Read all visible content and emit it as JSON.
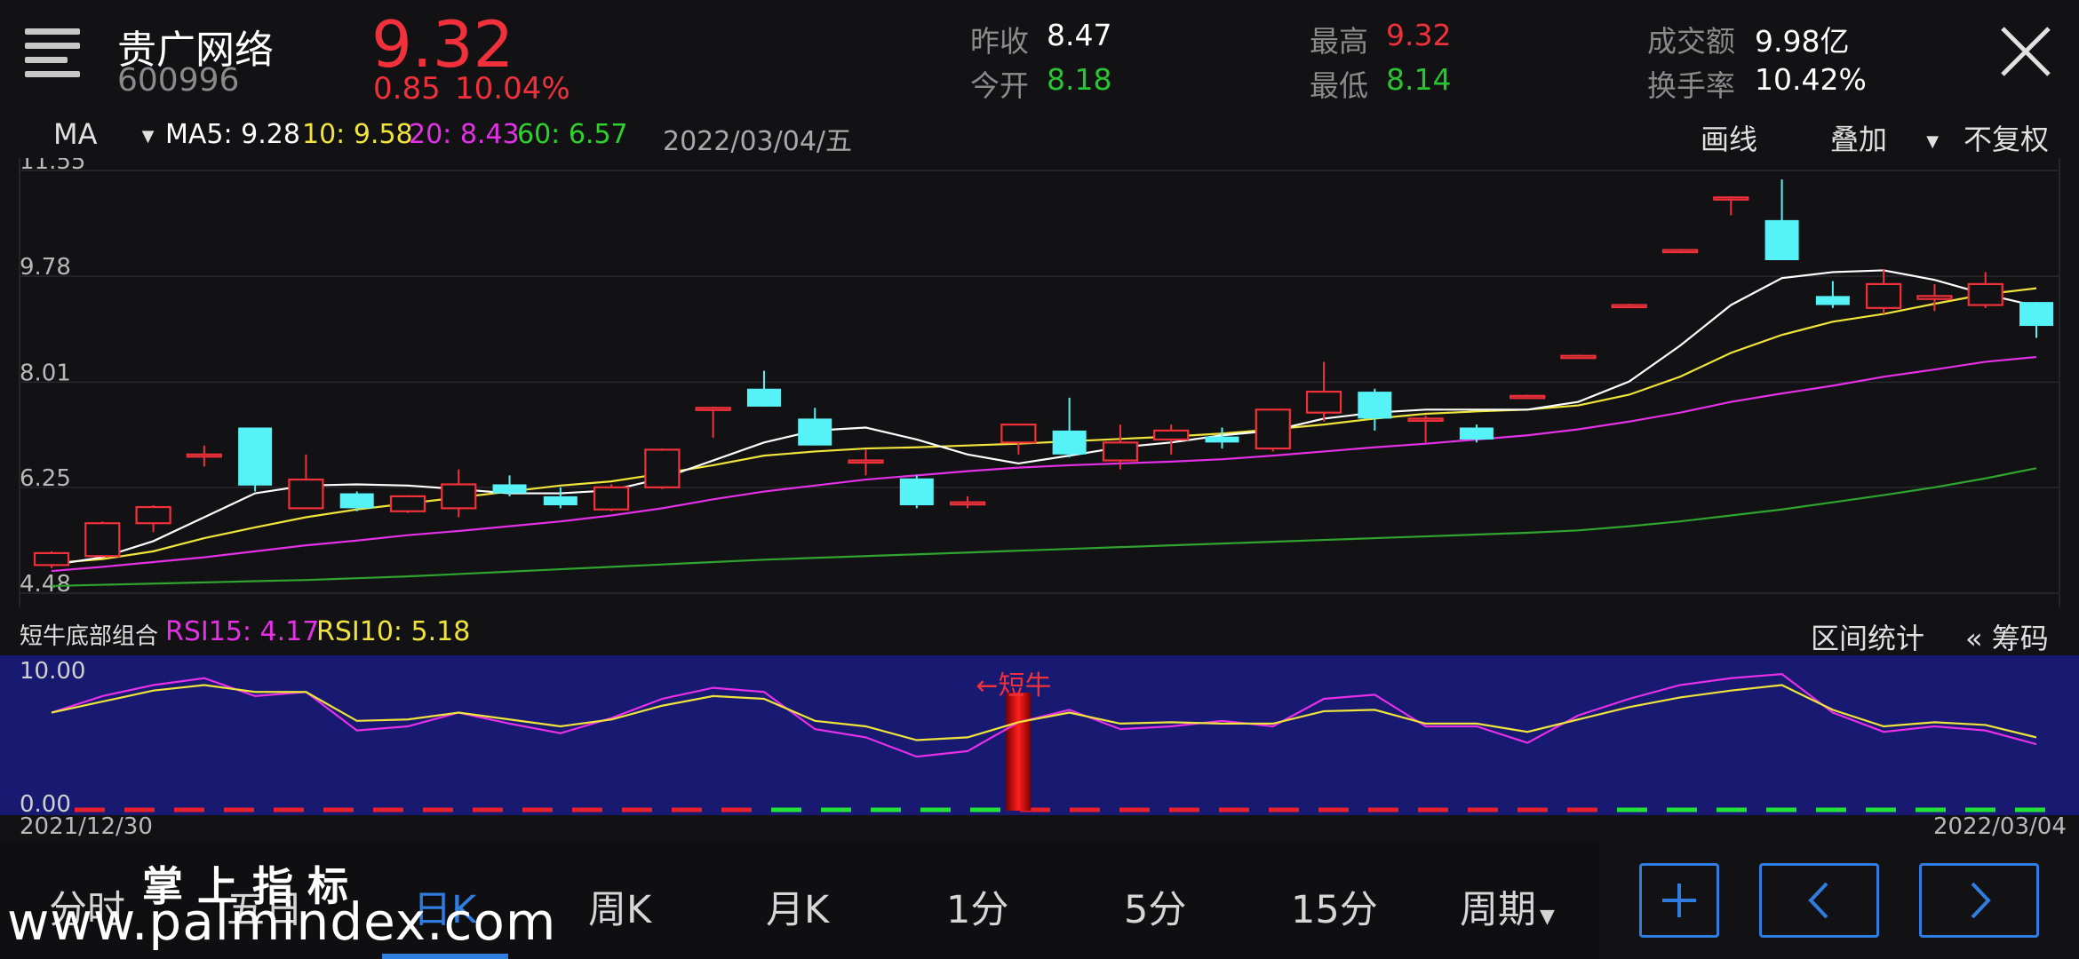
{
  "header": {
    "stock_name": "贵广网络",
    "stock_code": "600996",
    "price": "9.32",
    "change": "0.85",
    "change_pct": "10.04%",
    "prev_close_label": "昨收",
    "prev_close": "8.47",
    "open_label": "今开",
    "open": "8.18",
    "high_label": "最高",
    "high": "9.32",
    "low_label": "最低",
    "low": "8.14",
    "turnover_amt_label": "成交额",
    "turnover_amt": "9.98亿",
    "turnover_rate_label": "换手率",
    "turnover_rate": "10.42%"
  },
  "ma_bar": {
    "indicator": "MA",
    "ma5": "MA5: 9.28",
    "ma10": "10: 9.58",
    "ma20": "20: 8.43",
    "ma60": "60: 6.57",
    "date": "2022/03/04/五",
    "draw": "画线",
    "overlay": "叠加",
    "adjust": "不复权"
  },
  "sub_bar": {
    "indicator_name": "短牛底部组合",
    "rsi15": "RSI15: 4.17",
    "rsi10": "RSI10: 5.18",
    "range_stats": "区间统计",
    "chips": "« 筹码"
  },
  "sub_chart_annotation": "←短牛",
  "dates": {
    "start": "2021/12/30",
    "end": "2022/03/04"
  },
  "tabs": [
    "分时",
    "五日",
    "日K",
    "周K",
    "月K",
    "1分",
    "5分",
    "15分",
    "周期"
  ],
  "active_tab": "日K",
  "watermark": {
    "title": "掌 上 指 标",
    "url": "www.palmindex.com"
  },
  "colors": {
    "up": "#f0303a",
    "down": "#55f3f8",
    "ma5": "#ffffff",
    "ma10": "#f0e43c",
    "ma20": "#e530e8",
    "ma60": "#2fa52f",
    "sub_bg": "#171a70",
    "accent": "#2f7de0"
  },
  "chart_data": [
    {
      "type": "candlestick",
      "y_ticks": [
        "11.55",
        "9.78",
        "8.01",
        "6.25",
        "4.48"
      ],
      "ylim": [
        4.48,
        11.55
      ],
      "candles": [
        {
          "o": 4.95,
          "c": 5.15,
          "h": 5.18,
          "l": 4.9
        },
        {
          "o": 5.1,
          "c": 5.65,
          "h": 5.68,
          "l": 5.08
        },
        {
          "o": 5.65,
          "c": 5.92,
          "h": 5.95,
          "l": 5.5
        },
        {
          "o": 6.8,
          "c": 6.8,
          "h": 6.95,
          "l": 6.6
        },
        {
          "o": 7.25,
          "c": 6.28,
          "h": 7.25,
          "l": 6.18
        },
        {
          "o": 5.9,
          "c": 6.38,
          "h": 6.8,
          "l": 5.9
        },
        {
          "o": 6.15,
          "c": 5.9,
          "h": 6.18,
          "l": 5.85
        },
        {
          "o": 5.85,
          "c": 6.1,
          "h": 6.12,
          "l": 5.82
        },
        {
          "o": 5.9,
          "c": 6.3,
          "h": 6.55,
          "l": 5.75
        },
        {
          "o": 6.3,
          "c": 6.15,
          "h": 6.45,
          "l": 6.1
        },
        {
          "o": 6.1,
          "c": 5.95,
          "h": 6.25,
          "l": 5.9
        },
        {
          "o": 5.88,
          "c": 6.25,
          "h": 6.3,
          "l": 5.85
        },
        {
          "o": 6.25,
          "c": 6.88,
          "h": 6.9,
          "l": 6.22
        },
        {
          "o": 7.58,
          "c": 7.58,
          "h": 7.6,
          "l": 7.08
        },
        {
          "o": 7.9,
          "c": 7.6,
          "h": 8.2,
          "l": 7.6
        },
        {
          "o": 7.4,
          "c": 6.95,
          "h": 7.58,
          "l": 6.95
        },
        {
          "o": 6.7,
          "c": 6.7,
          "h": 6.88,
          "l": 6.45
        },
        {
          "o": 6.4,
          "c": 5.95,
          "h": 6.45,
          "l": 5.9
        },
        {
          "o": 6.0,
          "c": 6.0,
          "h": 6.1,
          "l": 5.9
        },
        {
          "o": 7.0,
          "c": 7.3,
          "h": 7.3,
          "l": 6.8
        },
        {
          "o": 7.2,
          "c": 6.8,
          "h": 7.75,
          "l": 6.75
        },
        {
          "o": 6.7,
          "c": 7.0,
          "h": 7.3,
          "l": 6.55
        },
        {
          "o": 7.05,
          "c": 7.2,
          "h": 7.3,
          "l": 6.8
        },
        {
          "o": 7.1,
          "c": 7.0,
          "h": 7.25,
          "l": 6.9
        },
        {
          "o": 6.9,
          "c": 7.55,
          "h": 7.55,
          "l": 6.85
        },
        {
          "o": 7.5,
          "c": 7.85,
          "h": 8.35,
          "l": 7.35
        },
        {
          "o": 7.85,
          "c": 7.4,
          "h": 7.9,
          "l": 7.2
        },
        {
          "o": 7.4,
          "c": 7.4,
          "h": 7.45,
          "l": 7.0
        },
        {
          "o": 7.25,
          "c": 7.05,
          "h": 7.3,
          "l": 7.0
        },
        {
          "o": 7.78,
          "c": 7.78,
          "h": 7.8,
          "l": 7.78
        },
        {
          "o": 8.45,
          "c": 8.45,
          "h": 8.47,
          "l": 8.45
        },
        {
          "o": 9.3,
          "c": 9.3,
          "h": 9.32,
          "l": 9.3
        },
        {
          "o": 10.22,
          "c": 10.22,
          "h": 10.24,
          "l": 10.22
        },
        {
          "o": 11.1,
          "c": 11.1,
          "h": 11.12,
          "l": 10.8
        },
        {
          "o": 10.72,
          "c": 10.05,
          "h": 11.4,
          "l": 10.05
        },
        {
          "o": 9.45,
          "c": 9.3,
          "h": 9.7,
          "l": 9.25
        },
        {
          "o": 9.25,
          "c": 9.65,
          "h": 9.9,
          "l": 9.15
        },
        {
          "o": 9.4,
          "c": 9.45,
          "h": 9.65,
          "l": 9.2
        },
        {
          "o": 9.3,
          "c": 9.65,
          "h": 9.85,
          "l": 9.25
        },
        {
          "o": 9.35,
          "c": 8.95,
          "h": 9.35,
          "l": 8.75
        }
      ],
      "ma5": [
        4.95,
        5.08,
        5.35,
        5.75,
        6.15,
        6.28,
        6.3,
        6.28,
        6.22,
        6.15,
        6.15,
        6.2,
        6.4,
        6.7,
        7.0,
        7.2,
        7.25,
        7.05,
        6.8,
        6.65,
        6.78,
        6.92,
        7.0,
        7.12,
        7.2,
        7.4,
        7.5,
        7.55,
        7.55,
        7.55,
        7.68,
        8.02,
        8.62,
        9.3,
        9.75,
        9.85,
        9.88,
        9.72,
        9.48,
        9.28
      ],
      "ma10": [
        4.98,
        5.05,
        5.18,
        5.4,
        5.58,
        5.75,
        5.88,
        5.98,
        6.08,
        6.18,
        6.28,
        6.35,
        6.48,
        6.62,
        6.78,
        6.85,
        6.9,
        6.92,
        6.95,
        6.98,
        7.02,
        7.06,
        7.1,
        7.15,
        7.22,
        7.3,
        7.4,
        7.48,
        7.52,
        7.55,
        7.62,
        7.8,
        8.1,
        8.5,
        8.8,
        9.02,
        9.15,
        9.32,
        9.48,
        9.58
      ],
      "ma20": [
        4.85,
        4.92,
        5.0,
        5.08,
        5.18,
        5.28,
        5.36,
        5.45,
        5.52,
        5.6,
        5.68,
        5.78,
        5.9,
        6.05,
        6.18,
        6.28,
        6.38,
        6.45,
        6.52,
        6.58,
        6.62,
        6.65,
        6.68,
        6.72,
        6.78,
        6.85,
        6.92,
        6.98,
        7.05,
        7.12,
        7.22,
        7.35,
        7.5,
        7.68,
        7.82,
        7.95,
        8.1,
        8.22,
        8.35,
        8.43
      ],
      "ma60": [
        4.6,
        4.62,
        4.64,
        4.66,
        4.68,
        4.7,
        4.73,
        4.76,
        4.8,
        4.84,
        4.88,
        4.92,
        4.96,
        5.0,
        5.04,
        5.07,
        5.1,
        5.13,
        5.16,
        5.19,
        5.22,
        5.25,
        5.28,
        5.31,
        5.34,
        5.37,
        5.4,
        5.43,
        5.46,
        5.49,
        5.53,
        5.6,
        5.68,
        5.78,
        5.88,
        6.0,
        6.12,
        6.25,
        6.4,
        6.57
      ]
    },
    {
      "type": "line",
      "y_ticks": [
        "10.00",
        "0.00"
      ],
      "ylim": [
        0,
        10
      ],
      "series": [
        {
          "name": "RSI15",
          "values": [
            7.0,
            8.2,
            9.0,
            9.5,
            8.2,
            8.5,
            5.7,
            6.0,
            7.0,
            6.2,
            5.5,
            6.6,
            8.0,
            8.8,
            8.5,
            5.8,
            5.2,
            3.8,
            4.2,
            6.3,
            7.2,
            5.8,
            6.0,
            6.4,
            6.0,
            8.0,
            8.3,
            6.0,
            6.0,
            4.8,
            6.8,
            8.0,
            9.0,
            9.5,
            9.8,
            7.0,
            5.6,
            6.0,
            5.7,
            4.7
          ]
        },
        {
          "name": "RSI10",
          "values": [
            7.0,
            7.8,
            8.6,
            9.0,
            8.5,
            8.5,
            6.4,
            6.5,
            7.0,
            6.5,
            6.0,
            6.5,
            7.5,
            8.2,
            8.0,
            6.4,
            6.0,
            5.0,
            5.2,
            6.3,
            7.0,
            6.2,
            6.3,
            6.2,
            6.2,
            7.1,
            7.2,
            6.2,
            6.2,
            5.6,
            6.5,
            7.4,
            8.1,
            8.6,
            9.0,
            7.2,
            6.0,
            6.3,
            6.1,
            5.2
          ]
        }
      ]
    }
  ]
}
